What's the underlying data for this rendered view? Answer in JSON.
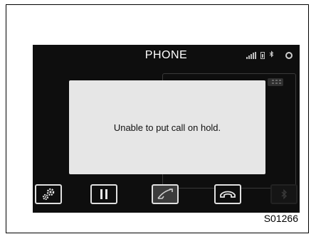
{
  "screen": {
    "title": "PHONE",
    "dialog_message": "Unable to put call on hold."
  },
  "status_icons": [
    "signal-icon",
    "battery-icon",
    "bluetooth-icon",
    "settings-icon"
  ],
  "toolbar": {
    "buttons": [
      {
        "icon": "settings-icon"
      },
      {
        "icon": "pause-icon"
      },
      {
        "icon": "handset-off-hook-icon",
        "active": true
      },
      {
        "icon": "end-call-icon"
      },
      {
        "icon": "bluetooth-icon",
        "disabled": true
      }
    ]
  },
  "figure_code": "S01266"
}
